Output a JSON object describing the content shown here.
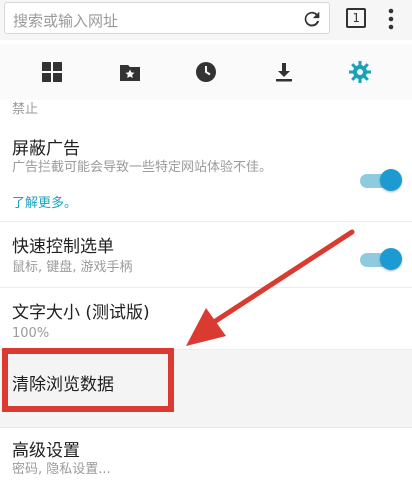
{
  "toolbar": {
    "search_placeholder": "搜索或输入网址",
    "tab_count": "1"
  },
  "icons": {
    "reload": "reload-icon",
    "tabs": "tab-count-icon",
    "menu": "overflow-menu-icon",
    "top_sites": "grid-icon",
    "bookmarks": "bookmark-star-icon",
    "history": "clock-icon",
    "downloads": "download-icon",
    "settings": "gear-icon"
  },
  "colors": {
    "accent": "#1aa3b8",
    "toggle_on": "#1b9bd1",
    "highlight": "#d93b30"
  },
  "settings": {
    "fragment_text": "禁止",
    "items": [
      {
        "title": "屏蔽广告",
        "subtitle": "广告拦截可能会导致一些特定网站体验不佳。",
        "link": "了解更多。",
        "toggle": true
      },
      {
        "title": "快速控制选单",
        "subtitle": "鼠标, 键盘, 游戏手柄",
        "toggle": true
      },
      {
        "title": "文字大小 (测试版)",
        "subtitle": "100%"
      },
      {
        "title": "清除浏览数据"
      },
      {
        "title": "高级设置",
        "subtitle": "密码, 隐私设置..."
      }
    ]
  }
}
